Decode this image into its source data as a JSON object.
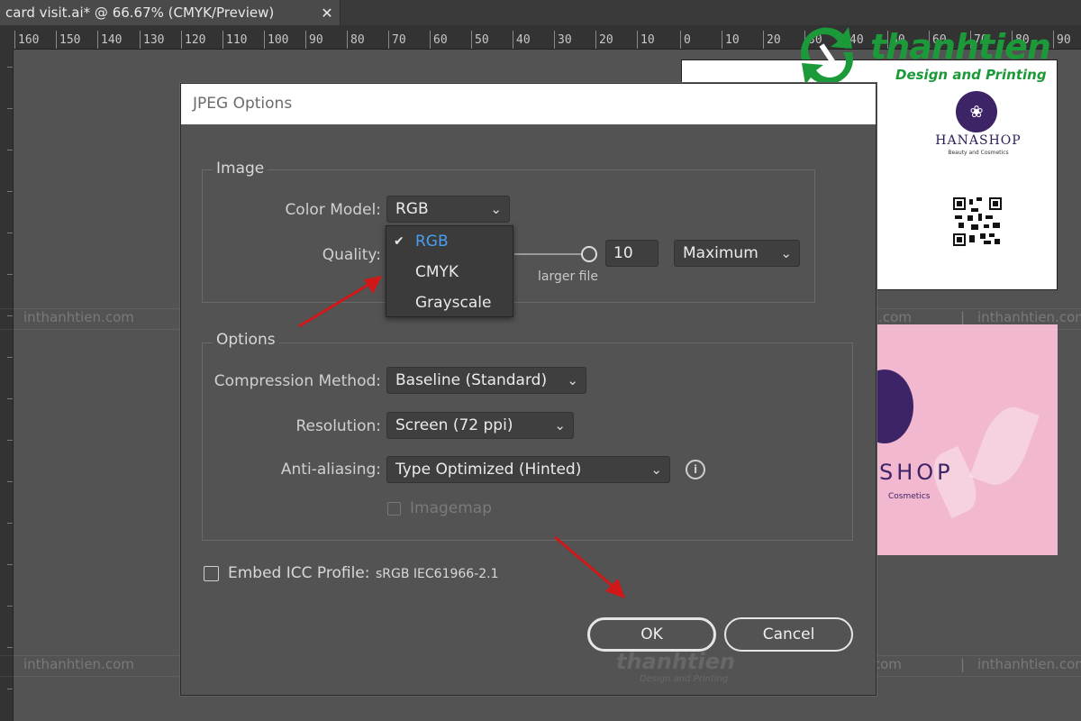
{
  "tab": {
    "title": "card visit.ai* @ 66.67% (CMYK/Preview)",
    "close": "✕"
  },
  "ruler": {
    "labels": [
      "160",
      "150",
      "140",
      "130",
      "120",
      "110",
      "100",
      "90",
      "80",
      "70",
      "60",
      "50",
      "40",
      "30",
      "20",
      "10",
      "0",
      "10",
      "20",
      "30",
      "40",
      "50",
      "60",
      "70",
      "80",
      "90"
    ]
  },
  "brand": {
    "name": "thanhtien",
    "tagline": "Design and Printing"
  },
  "watermark": {
    "text": "inthanhtien.com",
    "separator": "|"
  },
  "business_card": {
    "name": "HANASHOP",
    "tagline": "Beauty and Cosmetics",
    "name_back": "SHOP",
    "tagline_back": "Cosmetics",
    "logo_brand_color": "#3d2466",
    "card_pink": "#f2b8cf"
  },
  "dialog": {
    "title": "JPEG Options",
    "image_group": {
      "label": "Image",
      "color_model_label": "Color Model:",
      "color_model_value": "RGB",
      "quality_label": "Quality:",
      "quality_value": "10",
      "quality_preset": "Maximum",
      "larger_file_label": "larger file"
    },
    "color_model_menu": {
      "items": [
        "RGB",
        "CMYK",
        "Grayscale"
      ],
      "selected": "RGB",
      "check": "✔"
    },
    "options_group": {
      "label": "Options",
      "compression_label": "Compression Method:",
      "compression_value": "Baseline (Standard)",
      "resolution_label": "Resolution:",
      "resolution_value": "Screen (72 ppi)",
      "antialias_label": "Anti-aliasing:",
      "antialias_value": "Type Optimized (Hinted)",
      "imagemap_label": "Imagemap",
      "info": "i"
    },
    "embed_icc_label": "Embed ICC Profile:",
    "embed_icc_value": "sRGB IEC61966-2.1",
    "ok_label": "OK",
    "cancel_label": "Cancel"
  },
  "colors": {
    "selected_menu": "#4a9ff0",
    "arrow": "#d01818",
    "brand_green": "#1c9a3a"
  }
}
